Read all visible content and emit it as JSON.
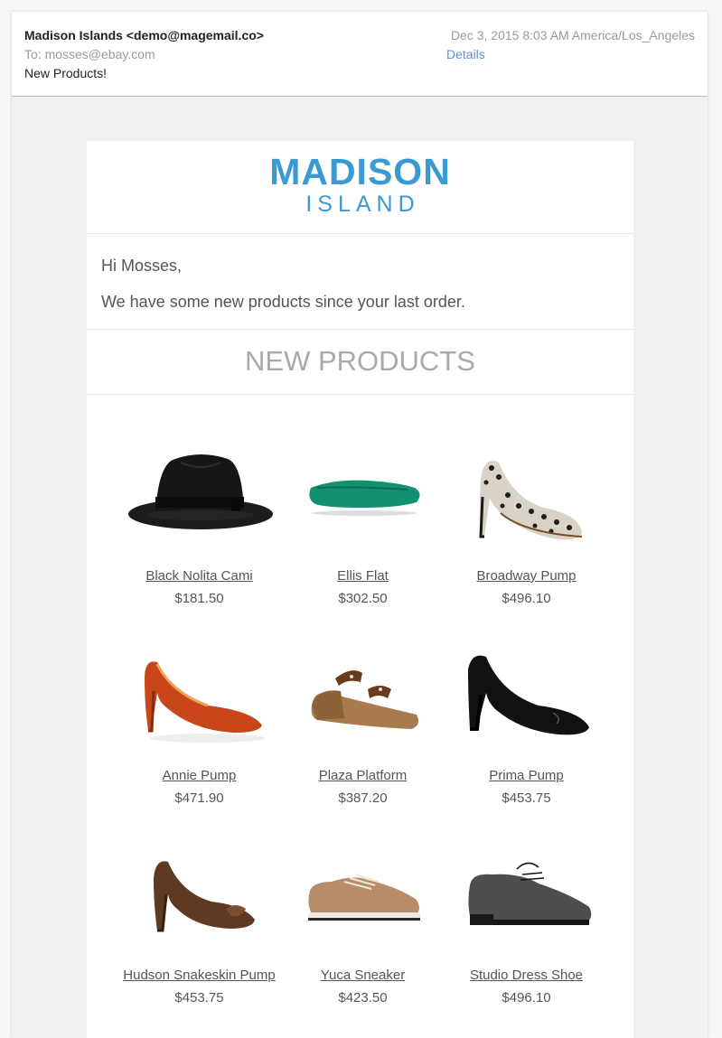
{
  "header": {
    "from": "Madison Islands <demo@magemail.co>",
    "to": "To: mosses@ebay.com",
    "subject": "New Products!",
    "date": "Dec 3, 2015 8:03 AM America/Los_Angeles",
    "details_link": "Details"
  },
  "email": {
    "logo_top": "MADISON",
    "logo_bottom": "ISLAND",
    "greeting": "Hi Mosses,",
    "intro": "We have some new products since your last order.",
    "section_title": "NEW PRODUCTS",
    "products": [
      {
        "name": "Black Nolita Cami",
        "price": "$181.50",
        "image": "black-fedora-hat"
      },
      {
        "name": "Ellis Flat",
        "price": "$302.50",
        "image": "green-ballet-flat"
      },
      {
        "name": "Broadway Pump",
        "price": "$496.10",
        "image": "leopard-print-pump"
      },
      {
        "name": "Annie Pump",
        "price": "$471.90",
        "image": "red-snakeskin-pump"
      },
      {
        "name": "Plaza Platform",
        "price": "$387.20",
        "image": "wedge-platform-sandal"
      },
      {
        "name": "Prima Pump",
        "price": "$453.75",
        "image": "black-leather-pump"
      },
      {
        "name": "Hudson Snakeskin Pump",
        "price": "$453.75",
        "image": "brown-snakeskin-pump"
      },
      {
        "name": "Yuca Sneaker",
        "price": "$423.50",
        "image": "tan-sneaker"
      },
      {
        "name": "Studio Dress Shoe",
        "price": "$496.10",
        "image": "grey-dress-shoe"
      }
    ]
  },
  "colors": {
    "brand": "#3a9ad3",
    "link": "#5a8fd8",
    "text": "#555555",
    "muted": "#9a9a9a"
  }
}
